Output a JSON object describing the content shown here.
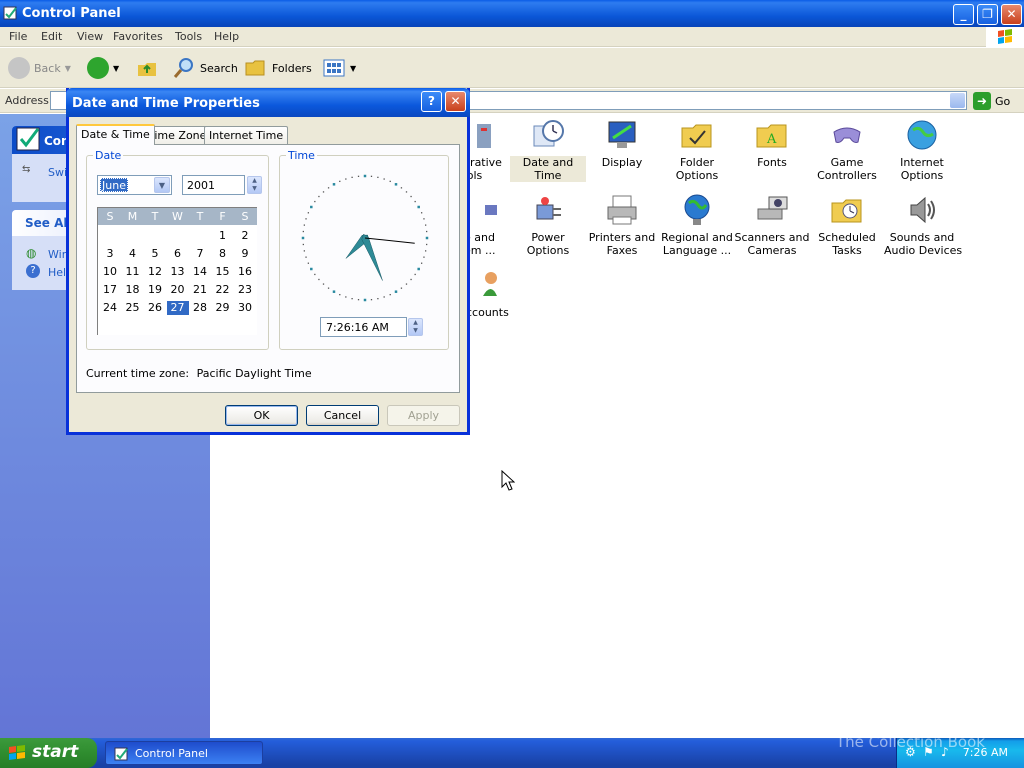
{
  "window": {
    "title": "Control Panel",
    "controls": {
      "minimize": "_",
      "restore": "❐",
      "close": "✕"
    }
  },
  "menu": [
    "File",
    "Edit",
    "View",
    "Favorites",
    "Tools",
    "Help"
  ],
  "toolbar": {
    "back": "Back",
    "search": "Search",
    "folders": "Folders"
  },
  "address": {
    "label": "Address",
    "go": "Go"
  },
  "taskpane": {
    "panel_title": "Con",
    "switch_link": "Swi",
    "see_also": "See Als",
    "links": [
      "Win",
      "Help"
    ]
  },
  "items": [
    {
      "label": "strative\nools"
    },
    {
      "label": "Date and Time"
    },
    {
      "label": "Display"
    },
    {
      "label": "Folder Options"
    },
    {
      "label": "Fonts"
    },
    {
      "label": "Game\nControllers"
    },
    {
      "label": "Internet\nOptions"
    },
    {
      "label": "e and\nem ..."
    },
    {
      "label": "Power Options"
    },
    {
      "label": "Printers and\nFaxes"
    },
    {
      "label": "Regional and\nLanguage ..."
    },
    {
      "label": "Scanners and\nCameras"
    },
    {
      "label": "Scheduled\nTasks"
    },
    {
      "label": "Sounds and\nAudio Devices"
    },
    {
      "label": "ccounts"
    }
  ],
  "dialog": {
    "title": "Date and Time Properties",
    "help": "?",
    "close": "✕",
    "tabs": [
      "Date & Time",
      "Time Zone",
      "Internet Time"
    ],
    "date_group": "Date",
    "time_group": "Time",
    "month": "June",
    "year": "2001",
    "weekdays": [
      "S",
      "M",
      "T",
      "W",
      "T",
      "F",
      "S"
    ],
    "calendar_weeks": [
      [
        "",
        "",
        "",
        "",
        "",
        "1",
        "2"
      ],
      [
        "3",
        "4",
        "5",
        "6",
        "7",
        "8",
        "9"
      ],
      [
        "10",
        "11",
        "12",
        "13",
        "14",
        "15",
        "16"
      ],
      [
        "17",
        "18",
        "19",
        "20",
        "21",
        "22",
        "23"
      ],
      [
        "24",
        "25",
        "26",
        "27",
        "28",
        "29",
        "30"
      ]
    ],
    "selected_day": "27",
    "clock": {
      "hour": 7,
      "minute": 26,
      "second": 16
    },
    "time": "7:26:16 AM",
    "timezone_label": "Current time zone:",
    "timezone": "Pacific Daylight Time",
    "buttons": {
      "ok": "OK",
      "cancel": "Cancel",
      "apply": "Apply"
    }
  },
  "taskbar": {
    "start": "start",
    "task": "Control Panel",
    "clock": "7:26 AM",
    "watermark": "The Collection Book"
  }
}
